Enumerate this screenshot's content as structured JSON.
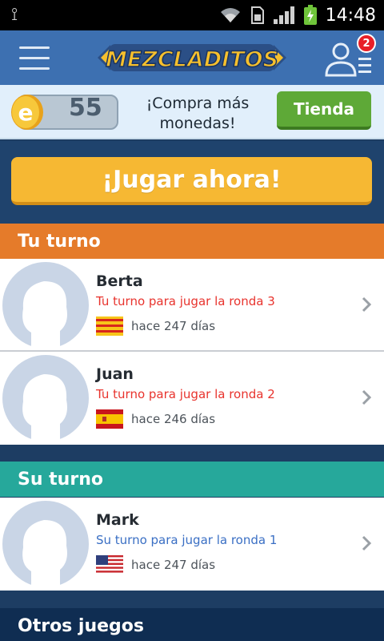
{
  "status_bar": {
    "time": "14:48"
  },
  "header": {
    "logo_text": "MEZCLADITOS",
    "friends_badge": "2"
  },
  "coins": {
    "count": "55",
    "promo_text_line1": "¡Compra más",
    "promo_text_line2": "monedas!",
    "shop_button": "Tienda"
  },
  "play": {
    "label": "¡Jugar ahora!"
  },
  "sections": {
    "your_turn": "Tu turno",
    "their_turn": "Su turno",
    "other_games": "Otros juegos"
  },
  "games": [
    {
      "name": "Berta",
      "status": "Tu turno para jugar la ronda 3",
      "ago": "hace 247 días",
      "flag": "catalonia"
    },
    {
      "name": "Juan",
      "status": "Tu turno para jugar la ronda 2",
      "ago": "hace 246 días",
      "flag": "spain"
    },
    {
      "name": "Mark",
      "status": "Su turno para jugar la ronda 1",
      "ago": "hace 247 días",
      "flag": "usa"
    }
  ],
  "colors": {
    "header": "#3d70b1",
    "your_turn": "#e57b2a",
    "their_turn": "#26a89b",
    "play_button": "#f6b833",
    "shop_button": "#5ea937",
    "status_red": "#e8332d",
    "status_blue": "#3a6fc4"
  }
}
